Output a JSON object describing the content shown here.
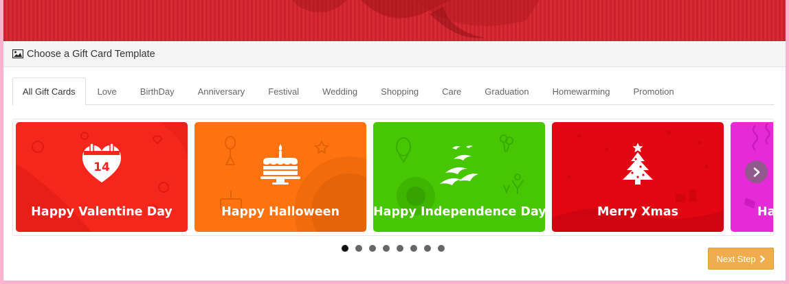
{
  "panel": {
    "title": "Choose a Gift Card Template",
    "icon": "picture-icon"
  },
  "tabs": [
    {
      "label": "All Gift Cards",
      "active": true
    },
    {
      "label": "Love"
    },
    {
      "label": "BirthDay"
    },
    {
      "label": "Anniversary"
    },
    {
      "label": "Festival"
    },
    {
      "label": "Wedding"
    },
    {
      "label": "Shopping"
    },
    {
      "label": "Care"
    },
    {
      "label": "Graduation"
    },
    {
      "label": "Homewarming"
    },
    {
      "label": "Promotion"
    }
  ],
  "cards": [
    {
      "label": "Happy Valentine Day",
      "color": "#f5261c",
      "icon": "calendar-heart-icon",
      "date": "14"
    },
    {
      "label": "Happy Halloween",
      "color": "#ff7210",
      "icon": "cake-icon"
    },
    {
      "label": "Happy Independence Day",
      "color": "#47c702",
      "icon": "birds-icon"
    },
    {
      "label": "Merry Xmas",
      "color": "#e20612",
      "icon": "christmas-tree-icon"
    },
    {
      "label": "Ha",
      "color": "#e52bd7",
      "icon": "party-icon"
    }
  ],
  "carousel": {
    "pages": 8,
    "current": 1
  },
  "buttons": {
    "next_step": "Next Step"
  }
}
